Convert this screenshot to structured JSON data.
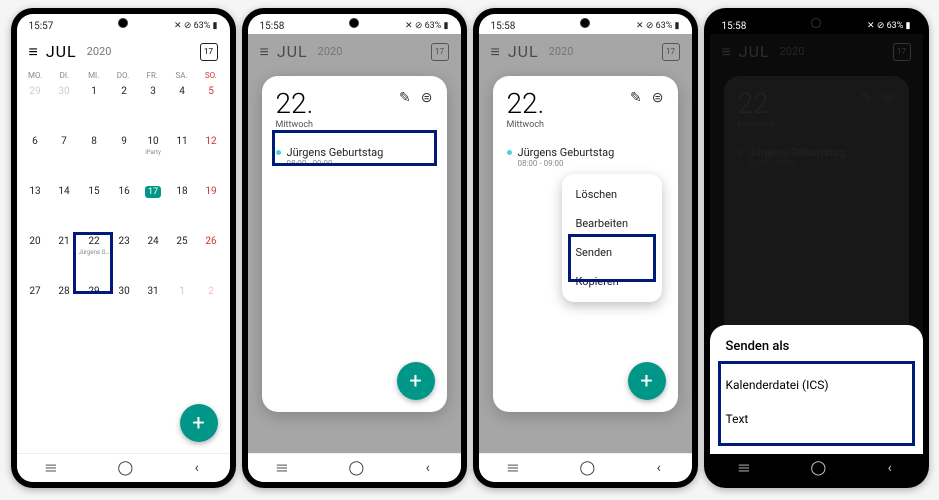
{
  "status": {
    "time1": "15:57",
    "time2": "15:58",
    "battery": "63%",
    "icons": "✕ ⊘ 63% ▮"
  },
  "header": {
    "month": "JUL",
    "year": "2020",
    "today_num": "17"
  },
  "weekdays": [
    "MO.",
    "DI.",
    "MI.",
    "DO.",
    "FR.",
    "SA.",
    "SO."
  ],
  "calendar": {
    "rows": [
      [
        "29",
        "30",
        "1",
        "2",
        "3",
        "4",
        "5"
      ],
      [
        "6",
        "7",
        "8",
        "9",
        "10",
        "11",
        "12"
      ],
      [
        "13",
        "14",
        "15",
        "16",
        "17",
        "18",
        "19"
      ],
      [
        "20",
        "21",
        "22",
        "23",
        "24",
        "25",
        "26"
      ],
      [
        "27",
        "28",
        "29",
        "30",
        "31",
        "1",
        "2"
      ]
    ],
    "event_10": "iParty",
    "event_22": "Jürgens G…"
  },
  "day_card": {
    "num": "22.",
    "name": "Mittwoch",
    "event_title": "Jürgens Geburtstag",
    "event_time": "08:00 - 09:00"
  },
  "context": {
    "delete": "Löschen",
    "edit": "Bearbeiten",
    "send": "Senden",
    "copy": "Kopieren"
  },
  "sheet": {
    "title": "Senden als",
    "opt_ics": "Kalenderdatei (ICS)",
    "opt_text": "Text"
  },
  "fab": "+",
  "nav": {
    "recent": "|||",
    "home": "◯",
    "back": "‹"
  }
}
